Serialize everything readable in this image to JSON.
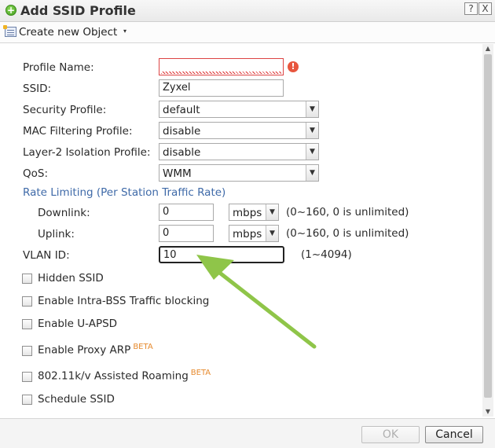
{
  "window": {
    "title": "Add SSID Profile",
    "help_label": "?",
    "close_label": "X",
    "add_icon": "add-circle-icon"
  },
  "toolbar": {
    "create_label": "Create new Object",
    "create_caret": "▾"
  },
  "form": {
    "profile_name": {
      "label": "Profile Name:",
      "value": "",
      "error_glyph": "!"
    },
    "ssid": {
      "label": "SSID:",
      "value": "Zyxel"
    },
    "security_profile": {
      "label": "Security Profile:",
      "value": "default"
    },
    "mac_filtering": {
      "label": "MAC Filtering Profile:",
      "value": "disable"
    },
    "layer2_isolation": {
      "label": "Layer-2 Isolation Profile:",
      "value": "disable"
    },
    "qos": {
      "label": "QoS:",
      "value": "WMM"
    },
    "rate_limit_title": "Rate Limiting (Per Station Traffic Rate)",
    "downlink": {
      "label": "Downlink:",
      "value": "0",
      "unit": "mbps",
      "hint": "(0~160, 0 is unlimited)"
    },
    "uplink": {
      "label": "Uplink:",
      "value": "0",
      "unit": "mbps",
      "hint": "(0~160, 0 is unlimited)"
    },
    "vlan": {
      "label": "VLAN ID:",
      "value": "10",
      "hint": "(1~4094)"
    },
    "checkboxes": {
      "hidden_ssid": "Hidden SSID",
      "intra_bss": "Enable Intra-BSS Traffic blocking",
      "u_apsd": "Enable U-APSD",
      "proxy_arp": "Enable Proxy ARP",
      "roaming": "802.11k/v Assisted Roaming",
      "schedule": "Schedule SSID",
      "beta_tag": "BETA"
    }
  },
  "footer": {
    "ok_label": "OK",
    "cancel_label": "Cancel"
  },
  "colors": {
    "section_blue": "#3f6aa8",
    "annotation_arrow": "#8fc549",
    "beta_orange": "#e68a2e",
    "error_red": "#e8563e"
  },
  "select_arrow": "▼",
  "scroll_up_glyph": "▲",
  "scroll_down_glyph": "▼"
}
